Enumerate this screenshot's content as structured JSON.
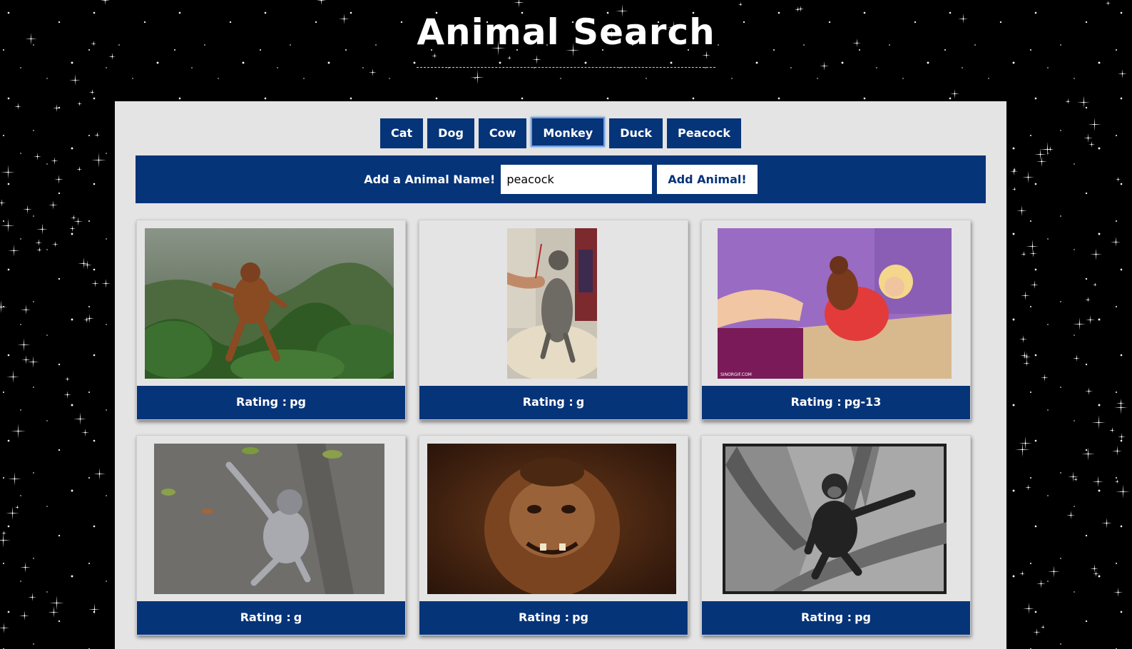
{
  "header": {
    "title": "Animal Search"
  },
  "animals": [
    {
      "label": "Cat",
      "active": false
    },
    {
      "label": "Dog",
      "active": false
    },
    {
      "label": "Cow",
      "active": false
    },
    {
      "label": "Monkey",
      "active": true
    },
    {
      "label": "Duck",
      "active": false
    },
    {
      "label": "Peacock",
      "active": false
    }
  ],
  "add_form": {
    "label": "Add a Animal Name!",
    "input_value": "peacock",
    "button_label": "Add Animal!"
  },
  "results": [
    {
      "rating_prefix": "Rating :",
      "rating": "pg",
      "image_desc": "orangutan-dancing-in-jungle"
    },
    {
      "rating_prefix": "Rating :",
      "rating": "g",
      "image_desc": "monkey-being-brushed"
    },
    {
      "rating_prefix": "Rating :",
      "rating": "pg-13",
      "image_desc": "orangutan-with-woman-on-bed",
      "watermark": "SINORGIF.COM"
    },
    {
      "rating_prefix": "Rating :",
      "rating": "g",
      "image_desc": "baby-monkey-on-pavement"
    },
    {
      "rating_prefix": "Rating :",
      "rating": "pg",
      "image_desc": "capuchin-monkey-grinning"
    },
    {
      "rating_prefix": "Rating :",
      "rating": "pg",
      "image_desc": "chimpanzee-in-tree-black-and-white"
    }
  ],
  "colors": {
    "brand_blue": "#063479",
    "panel_bg": "#e4e4e4",
    "page_bg": "#000000"
  }
}
